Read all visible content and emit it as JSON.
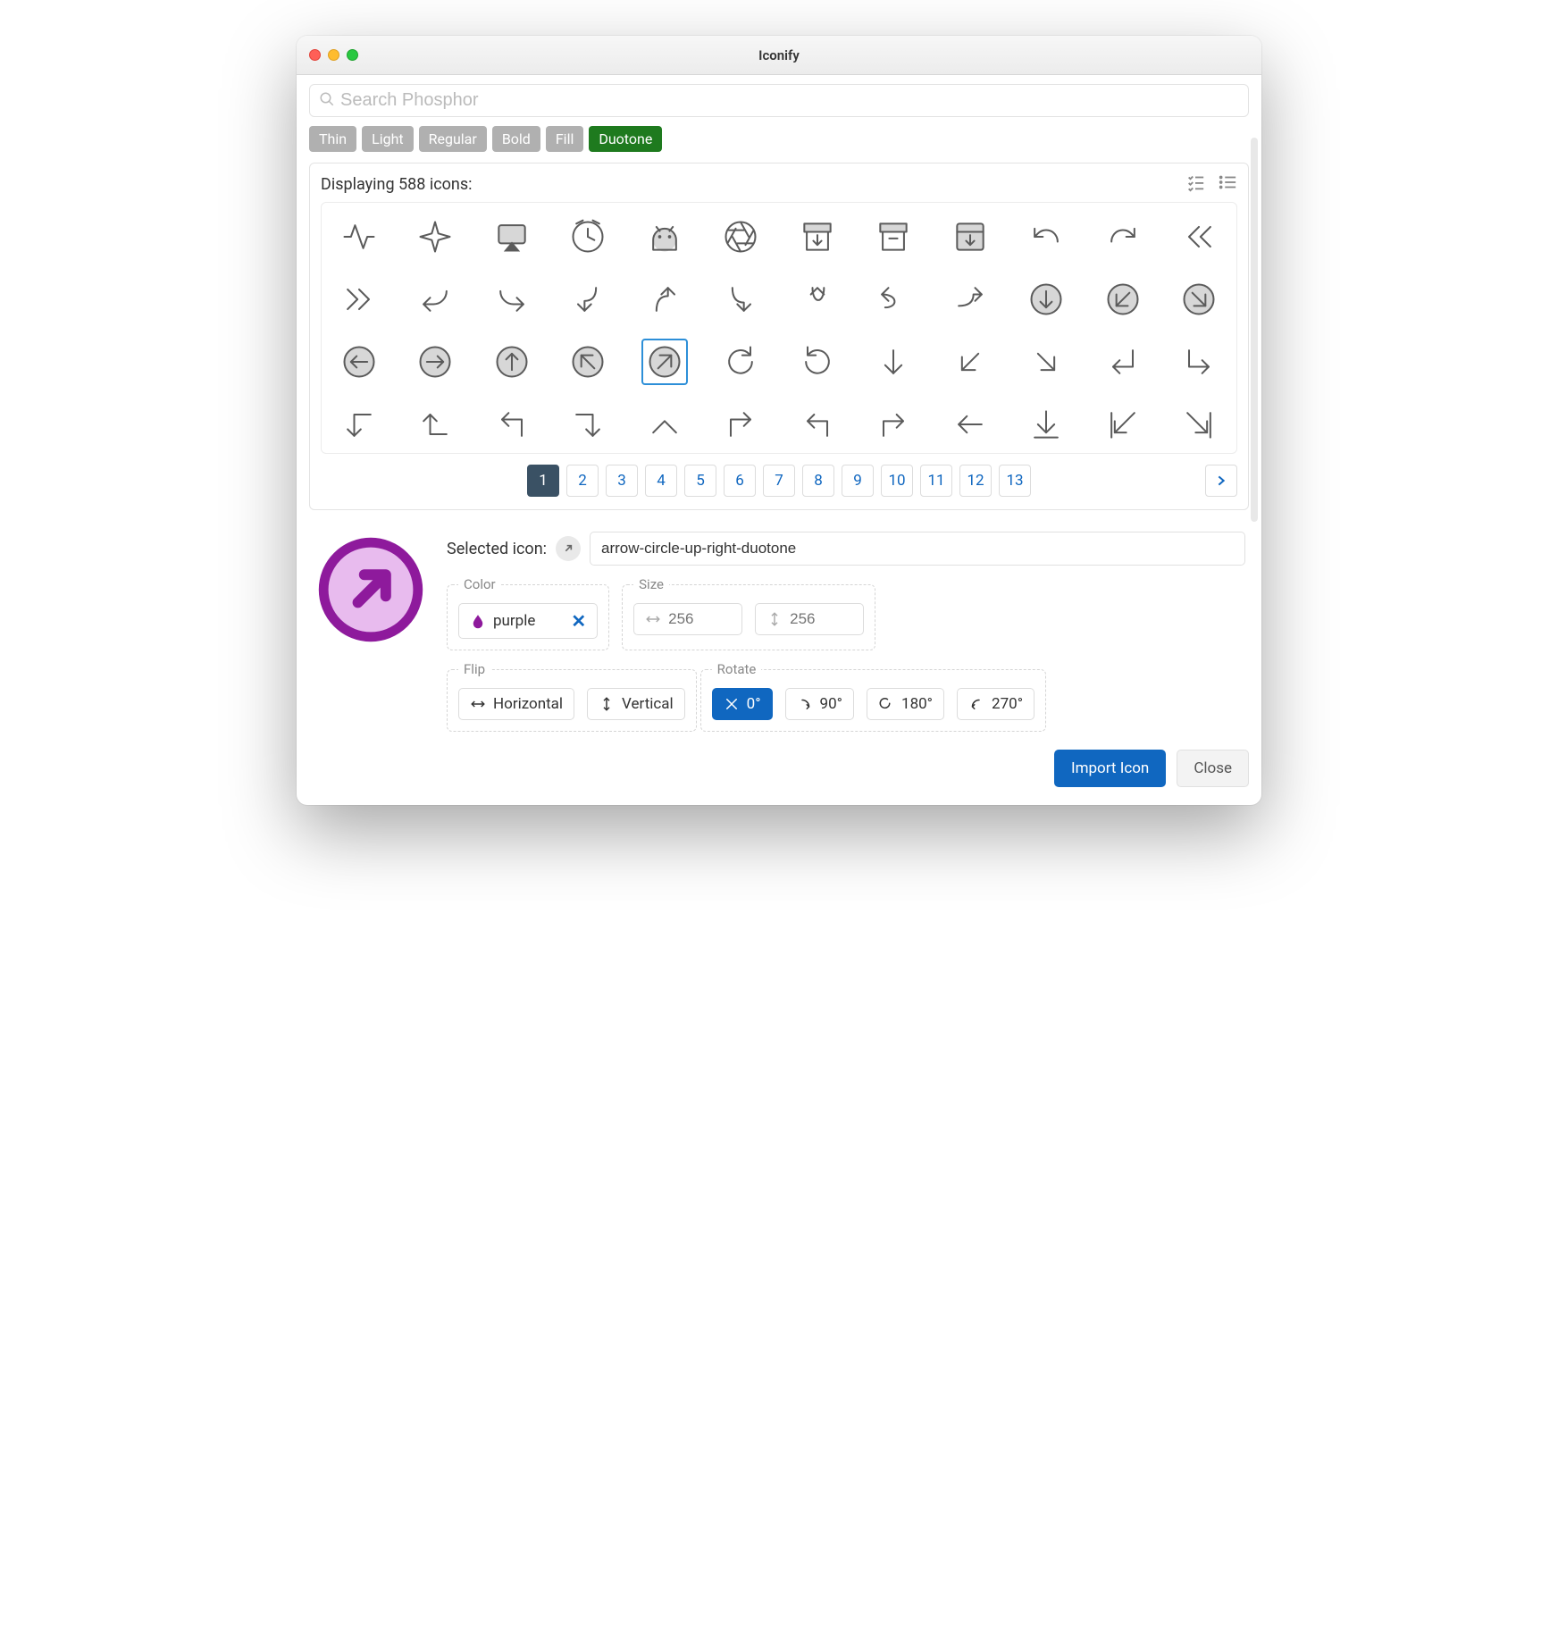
{
  "window": {
    "title": "Iconify"
  },
  "search": {
    "placeholder": "Search Phosphor"
  },
  "style_tabs": [
    "Thin",
    "Light",
    "Regular",
    "Bold",
    "Fill",
    "Duotone"
  ],
  "active_style_index": 5,
  "icon_count_text": "Displaying 588 icons:",
  "pages": [
    "1",
    "2",
    "3",
    "4",
    "5",
    "6",
    "7",
    "8",
    "9",
    "10",
    "11",
    "12",
    "13"
  ],
  "active_page_index": 0,
  "selected": {
    "label": "Selected icon:",
    "name": "arrow-circle-up-right-duotone"
  },
  "color": {
    "legend": "Color",
    "value": "purple",
    "swatch": "#8e1a9c",
    "accent_fill": "#e8bbee",
    "accent_stroke": "#8e1a9c"
  },
  "size": {
    "legend": "Size",
    "width_placeholder": "256",
    "height_placeholder": "256"
  },
  "flip": {
    "legend": "Flip",
    "h": "Horizontal",
    "v": "Vertical"
  },
  "rotate": {
    "legend": "Rotate",
    "options": [
      "0°",
      "90°",
      "180°",
      "270°"
    ],
    "active_index": 0
  },
  "footer": {
    "import": "Import Icon",
    "close": "Close"
  },
  "grid_icons": [
    "activity",
    "airplane",
    "airplay",
    "clock",
    "android",
    "aperture",
    "archive-down",
    "archive",
    "archive-box",
    "undo",
    "redo",
    "double-left",
    "double-right",
    "bend-left",
    "bend-right",
    "bend-down-left",
    "bend-up",
    "bend-down",
    "u-up",
    "u-left",
    "u-right",
    "circle-down",
    "circle-down-left",
    "circle-down-right",
    "circle-left",
    "circle-right",
    "circle-up",
    "circle-up-left",
    "circle-up-right",
    "rotate-cw",
    "rotate-ccw",
    "down",
    "down-left",
    "down-right",
    "elbow-down-left",
    "elbow-down-right",
    "elbow-left-down",
    "elbow-left-up",
    "elbow-up-left",
    "elbow-right-down",
    "elbow-up",
    "elbow-up-right",
    "corner-up-left",
    "corner-up-right",
    "left",
    "line-down",
    "line-down-left",
    "line-down-right"
  ],
  "selected_grid_index": 28
}
